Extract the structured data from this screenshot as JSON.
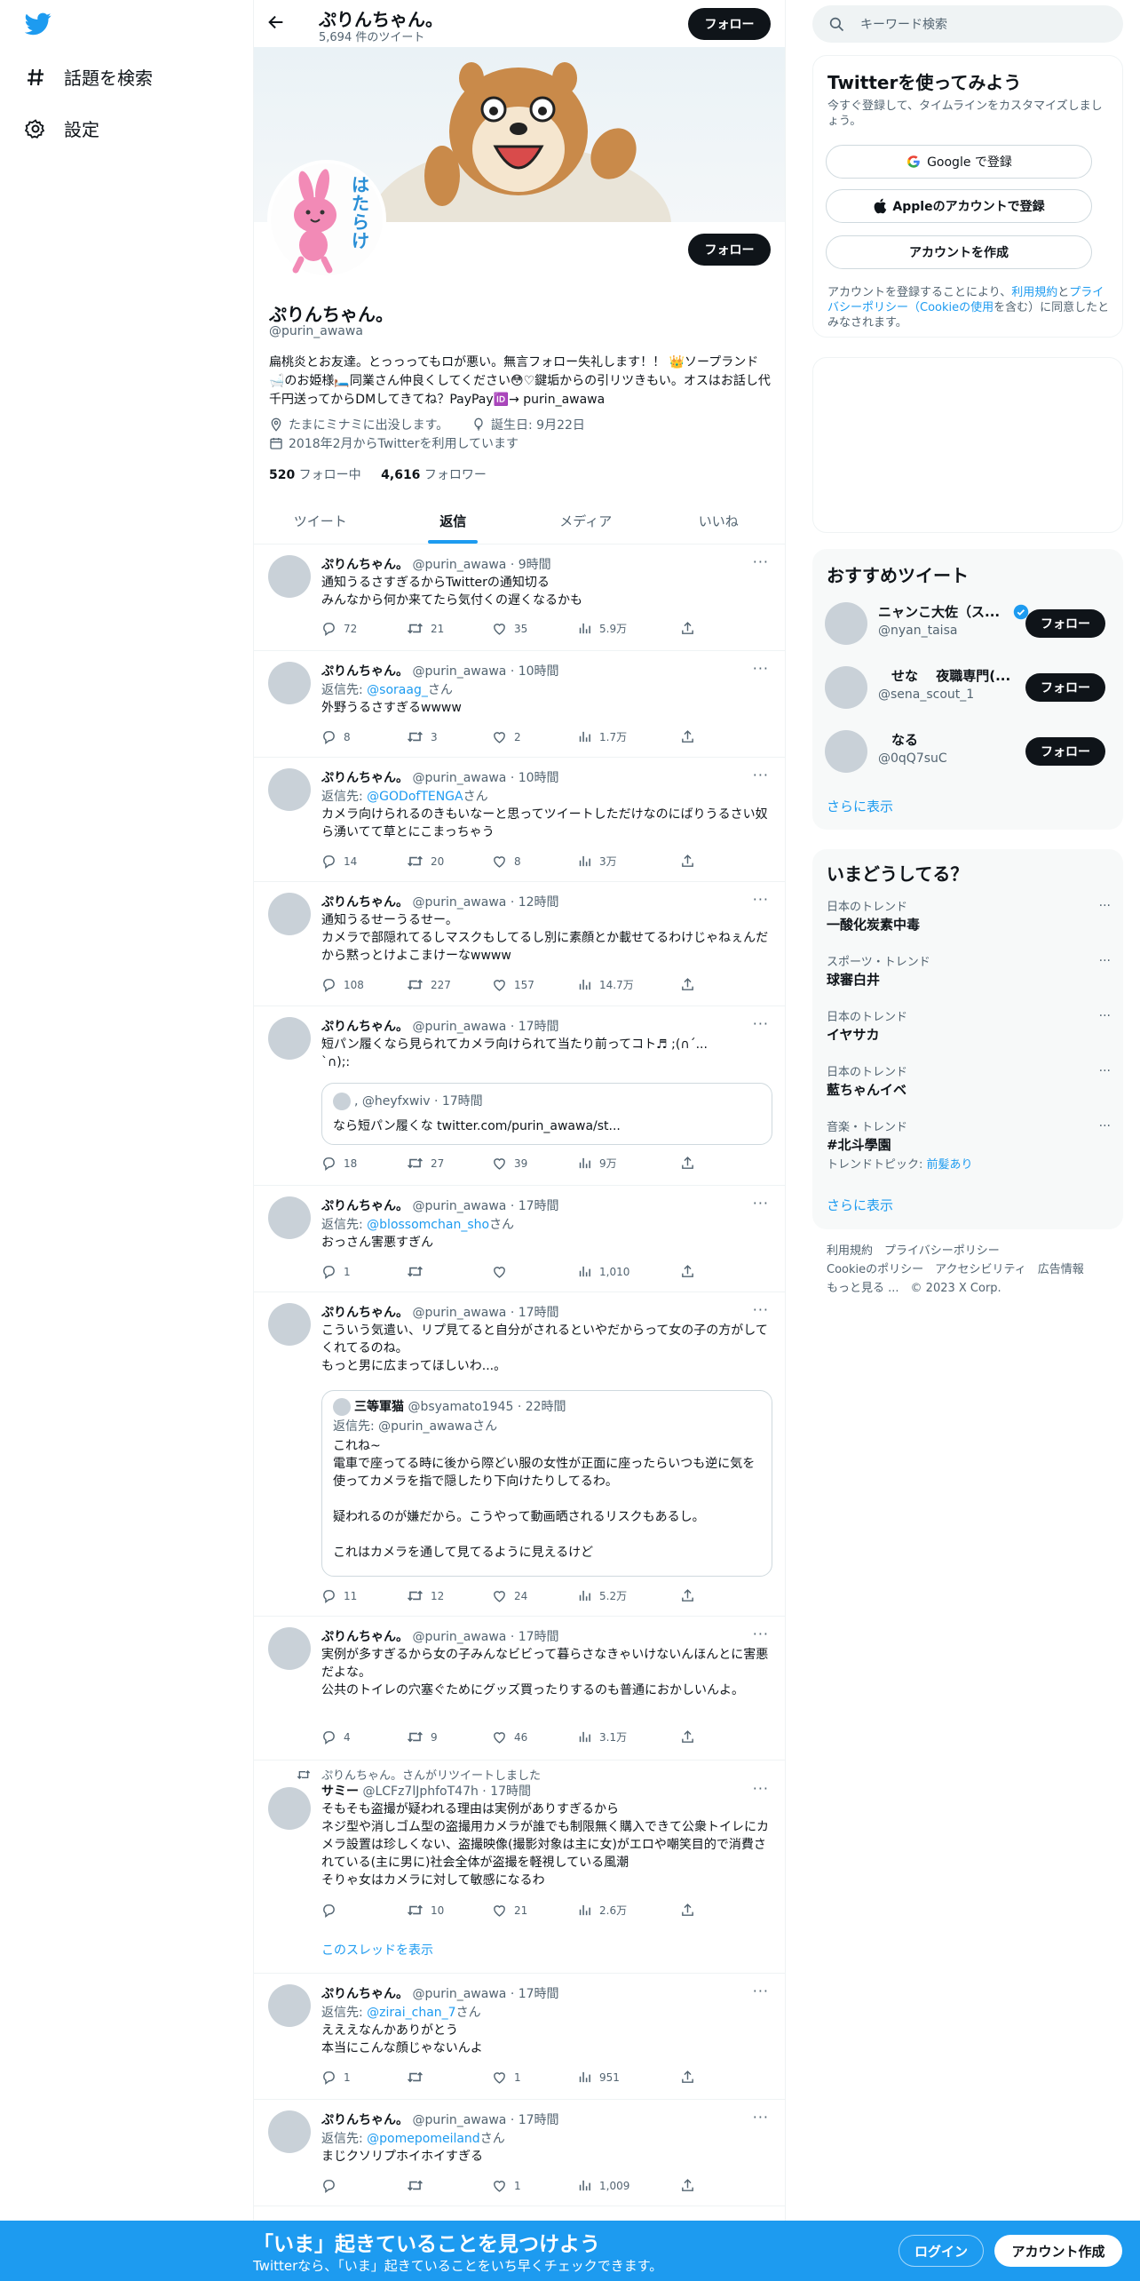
{
  "nav": {
    "explore_label": "話題を検索",
    "settings_label": "設定"
  },
  "profile": {
    "name": "ぷりんちゃん。",
    "tweet_count": "5,694 件のツイート",
    "follow_label": "フォロー",
    "handle": "@purin_awawa",
    "bio": "扁桃炎とお友達。とっっってもロが悪い。無言フォロー失礼します！！ 👑ソープランド🛁のお姫様🛏️同業さん仲良くしてください😳♡鍵垢からの引リツきもい。オスはお話し代千円送ってからDMしてきてね？PayPay🆔→ purin_awawa",
    "location": "たまにミナミに出没します。",
    "birthday": "誕生日: 9月22日",
    "joined": "2018年2月からTwitterを利用しています",
    "following_count": "520",
    "following_label": " フォロー中",
    "followers_count": "4,616",
    "followers_label": " フォロワー",
    "avatar_text": "はたらけ"
  },
  "tabs": [
    {
      "label": "ツイート"
    },
    {
      "label": "返信"
    },
    {
      "label": "メディア"
    },
    {
      "label": "いいね"
    }
  ],
  "tweets": [
    {
      "name": "ぷりんちゃん。",
      "meta": "@purin_awawa · 9時間",
      "text": "通知うるさすぎるからTwitterの通知切る\nみんなから何か来てたら気付くの遅くなるかも",
      "reply": "72",
      "rt": "21",
      "like": "35",
      "views": "5.9万"
    },
    {
      "name": "ぷりんちゃん。",
      "meta": "@purin_awawa · 10時間",
      "reply_prefix": "返信先: ",
      "reply_to": "@soraag_",
      "reply_suffix": "さん",
      "text": "外野うるさすぎるwwww",
      "reply": "8",
      "rt": "3",
      "like": "2",
      "views": "1.7万"
    },
    {
      "name": "ぷりんちゃん。",
      "meta": "@purin_awawa · 10時間",
      "reply_prefix": "返信先: ",
      "reply_to": "@GODofTENGA",
      "reply_suffix": "さん",
      "text": "カメラ向けられるのきもいなーと思ってツイートしただけなのにばりうるさい奴ら湧いてて草とにこまっちゃう",
      "reply": "14",
      "rt": "20",
      "like": "8",
      "views": "3万"
    },
    {
      "name": "ぷりんちゃん。",
      "meta": "@purin_awawa · 12時間",
      "text": "通知うるせーうるせー。\nカメラで部隠れてるしマスクもしてるし別に素顔とか載せてるわけじゃねぇんだから黙っとけよこまけーなwwww",
      "reply": "108",
      "rt": "227",
      "like": "157",
      "views": "14.7万"
    },
    {
      "name": "ぷりんちゃん。",
      "meta": "@purin_awawa · 17時間",
      "text": "短パン履くなら見られてカメラ向けられて当たり前ってコト♬ ;(∩´...\n`∩);:",
      "quote_handle": ", @heyfxwiv · 17時間",
      "quote_text": "なら短パン履くな twitter.com/purin_awawa/st...",
      "reply": "18",
      "rt": "27",
      "like": "39",
      "views": "9万"
    },
    {
      "name": "ぷりんちゃん。",
      "meta": "@purin_awawa · 17時間",
      "reply_prefix": "返信先: ",
      "reply_to": "@blossomchan_sho",
      "reply_suffix": "さん",
      "text": "おっさん害悪すぎん",
      "reply": "1",
      "rt": "",
      "like": "",
      "views": "1,010"
    },
    {
      "name": "ぷりんちゃん。",
      "meta": "@purin_awawa · 17時間",
      "text": "こういう気遣い、リプ見てると自分がされるといやだからって女の子の方がしてくれてるのね。\nもっと男に広まってほしいわ...。",
      "quote_name": "三等軍猫",
      "quote_handle": " @bsyamato1945 · 22時間",
      "quote_reply": "返信先: @purin_awawaさん",
      "quote_text": "これね~\n電車で座ってる時に後から際どい服の女性が正面に座ったらいつも逆に気を使ってカメラを指で隠したり下向けたりしてるわ。\n\n疑われるのが嫌だから。こうやって動画晒されるリスクもあるし。\n\nこれはカメラを通して見てるように見えるけど",
      "reply": "11",
      "rt": "12",
      "like": "24",
      "views": "5.2万"
    },
    {
      "name": "ぷりんちゃん。",
      "meta": "@purin_awawa · 17時間",
      "text": "実例が多すぎるから女の子みんなビビって暮らさなきゃいけないんほんとに害悪だよな。\n公共のトイレの穴塞ぐためにグッズ買ったりするのも普通におかしいんよ。",
      "reply": "4",
      "rt": "9",
      "like": "46",
      "views": "3.1万"
    },
    {
      "retweet_label": "ぷりんちゃん。さんがリツイートしました",
      "name": "サミー",
      "meta": "@LCFz7lJphfoT47h · 17時間",
      "text": "そもそも盗撮が疑われる理由は実例がありすぎるから\nネジ型や消しゴム型の盗撮用カメラが誰でも制限無く購入できて公衆トイレにカメラ設置は珍しくない、盗撮映像(撮影対象は主に女)がエロや嘲笑目的で消費されている(主に男に)社会全体が盗撮を軽視している風潮\nそりゃ女はカメラに対して敏感になるわ",
      "reply": "",
      "rt": "10",
      "like": "21",
      "views": "2.6万",
      "thread_label": "このスレッドを表示"
    },
    {
      "name": "ぷりんちゃん。",
      "meta": "@purin_awawa · 17時間",
      "reply_prefix": "返信先: ",
      "reply_to": "@zirai_chan_7",
      "reply_suffix": "さん",
      "text": "えええなんかありがとう\n本当にこんな顔じゃないんよ",
      "reply": "1",
      "rt": "",
      "like": "1",
      "views": "951"
    },
    {
      "name": "ぷりんちゃん。",
      "meta": "@purin_awawa · 17時間",
      "reply_prefix": "返信先: ",
      "reply_to": "@pomepomeiland",
      "reply_suffix": "さん",
      "text": "まじクソリプホイホイすぎる",
      "reply": "",
      "rt": "",
      "like": "1",
      "views": "1,009"
    }
  ],
  "right": {
    "search_placeholder": "キーワード検索",
    "signup_title": "Twitterを使ってみよう",
    "signup_sub": "今すぐ登録して、タイムラインをカスタマイズしましょう。",
    "google_label": "Google で登録",
    "apple_label": "Appleのアカウントで登録",
    "create_label": "アカウントを作成",
    "terms_1": "アカウントを登録することにより、",
    "terms_link1": "利用規約",
    "terms_2": "と",
    "terms_link2": "プライバシーポリシー（Cookieの使用",
    "terms_3": "を含む）に同意したとみなされます。",
    "rec_title": "おすすめツイート",
    "recs": [
      {
        "name": "ニャンこ大佐（ス...",
        "handle": "@nyan_taisa",
        "follow": "フォロー"
      },
      {
        "name": "　せな　 夜職専門(...",
        "handle": "@sena_scout_1",
        "follow": "フォロー"
      },
      {
        "name": "　なる",
        "handle": "@0qQ7suC",
        "follow": "フォロー"
      }
    ],
    "show_more": "さらに表示",
    "trends_title": "いまどうしてる？",
    "trends": [
      {
        "context": "日本のトレンド",
        "title": "一酸化炭素中毒"
      },
      {
        "context": "スポーツ・トレンド",
        "title": "球審白井"
      },
      {
        "context": "日本のトレンド",
        "title": "イヤサカ"
      },
      {
        "context": "日本のトレンド",
        "title": "藍ちゃんイベ"
      },
      {
        "context": "音楽・トレンド",
        "title": "#北斗學園",
        "topic_prefix": "トレンドトピック: ",
        "topic": "前髪あり"
      }
    ],
    "footer": {
      "terms": "利用規約",
      "privacy": "プライバシーポリシー",
      "cookie": "Cookieのポリシー",
      "a11y": "アクセシビリティ",
      "ads": "広告情報",
      "more": "もっと見る ...",
      "copyright": "© 2023 X Corp."
    }
  },
  "bottom": {
    "title": "「いま」起きていることを見つけよう",
    "sub": "Twitterなら、「いま」起きていることをいち早くチェックできます。",
    "login": "ログイン",
    "signup": "アカウント作成"
  },
  "colors": {
    "accent": "#1d9bf0",
    "text": "#0f1419",
    "muted": "#536471"
  }
}
